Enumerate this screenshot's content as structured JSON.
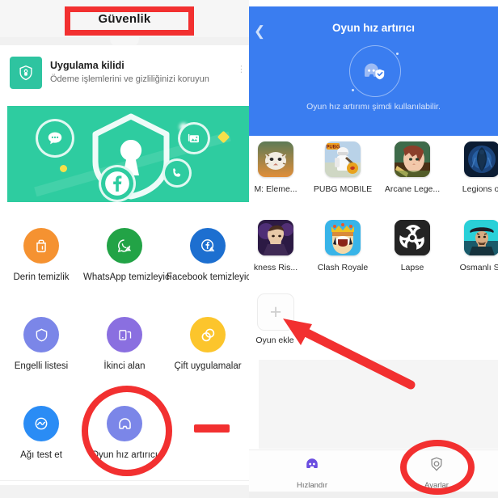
{
  "left_panel": {
    "header": {
      "title": "Güvenlik"
    },
    "app_lock": {
      "title": "Uygulama kilidi",
      "subtitle": "Ödeme işlemlerini ve gizliliğinizi koruyun",
      "icon": "shield-lock-icon",
      "overflow": "more-options-icon"
    },
    "banner": {
      "icon": "shield-keyhole-icon",
      "bubble_icons": [
        "chat-bubble-icon",
        "photo-gallery-icon",
        "phone-icon",
        "facebook-icon"
      ],
      "background_color": "#2ecca0"
    },
    "tools": [
      {
        "label": "Derin temizlik",
        "icon": "deep-clean-icon",
        "color": "#f59231"
      },
      {
        "label": "WhatsApp temizleyici",
        "icon": "whatsapp-cleaner-icon",
        "color": "#22a346"
      },
      {
        "label": "Facebook temizleyici",
        "icon": "facebook-cleaner-icon",
        "color": "#1d6fd0"
      },
      {
        "label": "Engelli listesi",
        "icon": "blocklist-shield-icon",
        "color": "#7b86e8"
      },
      {
        "label": "İkinci alan",
        "icon": "second-space-icon",
        "color": "#8a6fe0"
      },
      {
        "label": "Çift uygulamalar",
        "icon": "dual-apps-icon",
        "color": "#fcc52c"
      },
      {
        "label": "Ağı test et",
        "icon": "network-test-icon",
        "color": "#2a8cf5"
      },
      {
        "label": "Oyun hız artırıcı",
        "icon": "game-booster-icon",
        "color": "#7b86e8"
      }
    ]
  },
  "right_panel": {
    "header": {
      "back_icon": "back-chevron-icon",
      "title": "Oyun hız artırıcı",
      "hero_icon": "gamepad-shield-icon",
      "subtitle": "Oyun hız artırımı şimdi kullanılabilir.",
      "background_color": "#3a7df0"
    },
    "games": [
      {
        "label": "M: Eleme...",
        "icon": "game-tiger-icon"
      },
      {
        "label": "PUBG MOBILE",
        "icon": "game-pubg-icon"
      },
      {
        "label": "Arcane Lege...",
        "icon": "game-arcane-legends-icon"
      },
      {
        "label": "Legions of ",
        "icon": "game-legions-icon"
      },
      {
        "label": "kness Ris...",
        "icon": "game-darkness-rises-icon"
      },
      {
        "label": "Clash Royale",
        "icon": "game-clash-royale-icon"
      },
      {
        "label": "Lapse",
        "icon": "game-lapse-icon"
      },
      {
        "label": "Osmanlı Sa",
        "icon": "game-osmanli-icon"
      }
    ],
    "add_game": {
      "label": "Oyun ekle",
      "icon": "plus-icon"
    },
    "nav": [
      {
        "label": "Hızlandır",
        "icon": "gamepad-icon",
        "active": true
      },
      {
        "label": "Ayarlar",
        "icon": "gear-icon",
        "active": false
      }
    ]
  },
  "annotations": {
    "color": "#f23030",
    "items": [
      {
        "type": "rectangle",
        "target": "Güvenlik"
      },
      {
        "type": "circle",
        "target": "Oyun hız artırıcı"
      },
      {
        "type": "dash",
        "target": "separator-mark"
      },
      {
        "type": "arrow",
        "target": "Oyun ekle"
      },
      {
        "type": "ellipse",
        "target": "Ayarlar"
      }
    ]
  }
}
